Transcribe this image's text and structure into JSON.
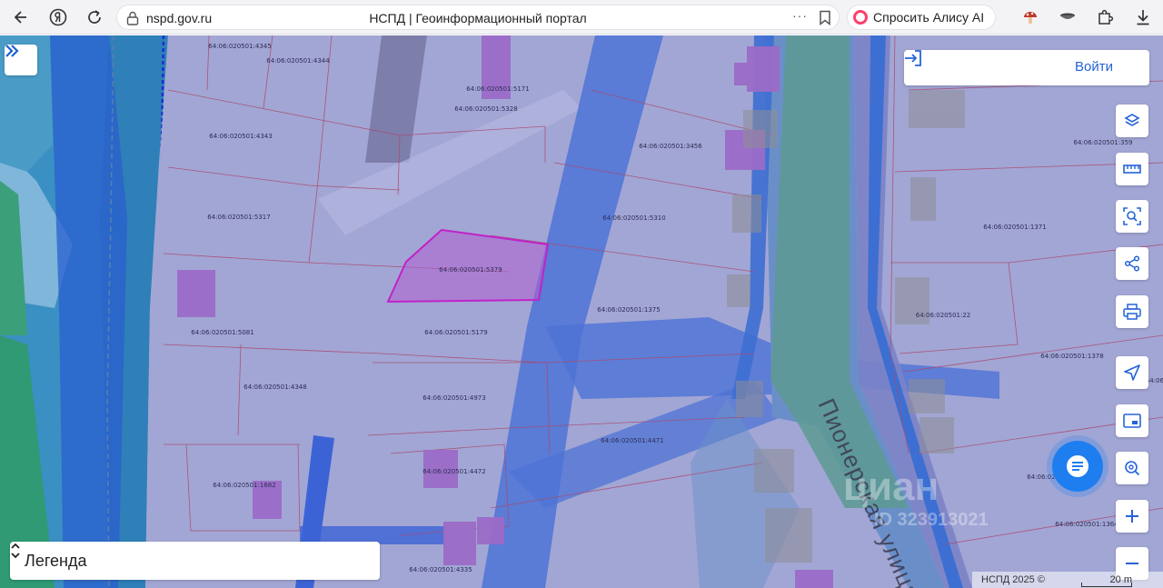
{
  "browser": {
    "url": "nspd.gov.ru",
    "page_title": "НСПД | Геоинформационный портал",
    "menu_dots": "···",
    "alice_label": "Спросить Алису AI"
  },
  "map": {
    "parcels": [
      {
        "label": "64:06:020501:4345"
      },
      {
        "label": "64:06:020501:4344"
      },
      {
        "label": "64:06:020501:5171"
      },
      {
        "label": "64:06:020501:5328"
      },
      {
        "label": "64:06:020501:4343"
      },
      {
        "label": "64:06:020501:3456"
      },
      {
        "label": "64:06:020501:359"
      },
      {
        "label": "64:06:020501:5317"
      },
      {
        "label": "64:06:020501:5310"
      },
      {
        "label": "64:06:020501:1371"
      },
      {
        "label": "64:06:020501:5379"
      },
      {
        "label": "64:06:020501:1375"
      },
      {
        "label": "64:06:020501:22"
      },
      {
        "label": "64:06:020501:5081"
      },
      {
        "label": "64:06:020501:5179"
      },
      {
        "label": "64:06:020501:1378"
      },
      {
        "label": "64:06:020501:4348"
      },
      {
        "label": "64:06:020501:4973"
      },
      {
        "label": "64:06:020501:4471"
      },
      {
        "label": "64:06:020501:1682"
      },
      {
        "label": "64:06:020501:4472"
      },
      {
        "label": "64:06:020501:1364"
      },
      {
        "label": "64:06:020501:4335"
      },
      {
        "label": "64:06:02"
      },
      {
        "label": "64:06:"
      }
    ],
    "street_label": "Пионерская улица",
    "watermark": "циан",
    "watermark_id": "ID 323913021"
  },
  "ui": {
    "login_label": "Войти",
    "legend_label": "Легенда",
    "attribution": "НСПД 2025 ©",
    "scale_label": "20 m"
  }
}
